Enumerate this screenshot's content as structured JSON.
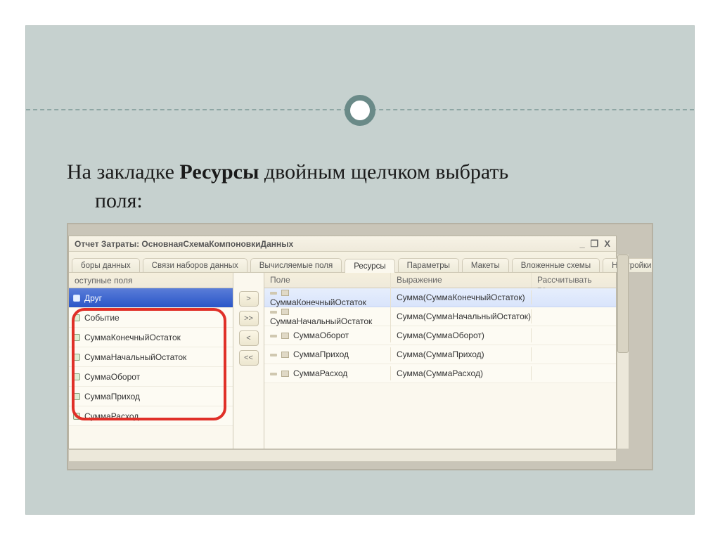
{
  "caption": {
    "pre": "На закладке ",
    "bold": "Ресурсы",
    "post1": " двойным щелчком выбрать",
    "post2": "поля:"
  },
  "window": {
    "title": "Отчет Затраты: ОсновнаяСхемаКомпоновкиДанных",
    "min": "_",
    "restore": "❐",
    "close": "X"
  },
  "tabs": [
    "боры данных",
    "Связи наборов данных",
    "Вычисляемые поля",
    "Ресурсы",
    "Параметры",
    "Макеты",
    "Вложенные схемы",
    "Настройки"
  ],
  "tabs_active_index": 3,
  "left_header": "оступные поля",
  "available_fields": [
    "Друг",
    "Событие",
    "СуммаКонечныйОстаток",
    "СуммаНачальныйОстаток",
    "СуммаОборот",
    "СуммаПриход",
    "СуммаРасход"
  ],
  "selected_index": 0,
  "cols": {
    "field": "Поле",
    "expr": "Выражение",
    "calc": "Рассчитывать по..."
  },
  "move_btns": {
    "add": ">",
    "add_all": ">>",
    "remove": "<",
    "remove_all": "<<"
  },
  "resources": [
    {
      "field": "СуммаКонечныйОстаток",
      "expr": "Сумма(СуммаКонечныйОстаток)"
    },
    {
      "field": "СуммаНачальныйОстаток",
      "expr": "Сумма(СуммаНачальныйОстаток)"
    },
    {
      "field": "СуммаОборот",
      "expr": "Сумма(СуммаОборот)"
    },
    {
      "field": "СуммаПриход",
      "expr": "Сумма(СуммаПриход)"
    },
    {
      "field": "СуммаРасход",
      "expr": "Сумма(СуммаРасход)"
    }
  ]
}
